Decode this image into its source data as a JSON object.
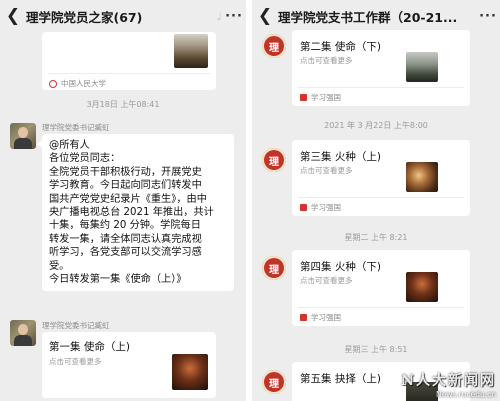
{
  "left": {
    "header": {
      "back_icon": "chevron-left-icon",
      "title": "理学院党员之家(67)",
      "mute_icon": "mute-bell-icon",
      "more_icon": "more-dots-icon"
    },
    "top_card": {
      "source": "中国人民大学"
    },
    "timestamp_1": "3月18日 上午08:41",
    "msg1": {
      "sender": "理学院党委书记臧虹",
      "lines": [
        "@所有人",
        "各位党员同志：",
        "全院党员干部积极行动，开展党史",
        "学习教育。今日起向同志们转发中",
        "国共产党党史纪录片《重生》，由中",
        "央广播电视总台 2021 年推出，共计",
        "十集，每集约 20 分钟。学院每日",
        "转发一集，请全体同志认真完成视",
        "听学习，各党支部可以交流学习感",
        "受。",
        "今日转发第一集《使命（上）》"
      ]
    },
    "msg2": {
      "sender": "理学院党委书记臧虹",
      "card_title": "第一集 使命（上)",
      "card_sub": "点击可查看更多"
    }
  },
  "right": {
    "header": {
      "back_icon": "chevron-left-icon",
      "title": "理学院党支书工作群（20-21...",
      "more_icon": "more-dots-icon"
    },
    "cards": [
      {
        "title": "第二集 使命（下)",
        "sub": "点击可查看更多",
        "source": "学习强国"
      },
      {
        "title": "第三集 火种（上)",
        "sub": "点击可查看更多",
        "source": "学习强国"
      },
      {
        "title": "第四集 火种（下)",
        "sub": "点击可查看更多",
        "source": "学习强国"
      },
      {
        "title": "第五集 抉择（上)"
      }
    ],
    "timestamps": [
      "2021 年 3 月22日 上午8:00",
      "星期二 上午 8:21",
      "星期三 上午 8:51"
    ],
    "logo_text": "理"
  },
  "watermark": {
    "big": "N人大新闻网",
    "url": "News.rucedu.cn"
  }
}
